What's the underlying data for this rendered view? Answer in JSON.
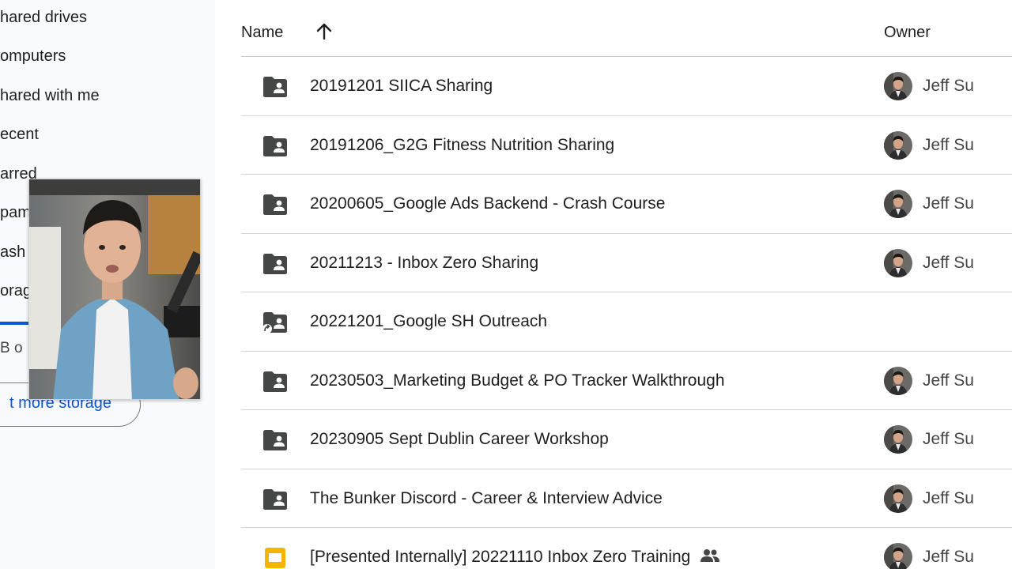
{
  "sidebar": {
    "items": [
      {
        "label": "hared drives"
      },
      {
        "label": "omputers"
      },
      {
        "label": "hared with me"
      },
      {
        "label": "ecent"
      },
      {
        "label": "arred"
      },
      {
        "label": "pam"
      },
      {
        "label": "ash"
      },
      {
        "label": "orag"
      }
    ],
    "storage": {
      "used_fraction": 0.2,
      "text": "B o",
      "button_label": "t more storage"
    }
  },
  "list": {
    "header": {
      "name_label": "Name",
      "owner_label": "Owner",
      "sort_icon": "arrow-up-icon"
    },
    "rows": [
      {
        "name": "20191201 SIICA Sharing",
        "icon": "shared-folder-icon",
        "owner": "Jeff Su"
      },
      {
        "name": "20191206_G2G Fitness Nutrition Sharing",
        "icon": "shared-folder-icon",
        "owner": "Jeff Su"
      },
      {
        "name": "20200605_Google Ads Backend - Crash Course",
        "icon": "shared-folder-icon",
        "owner": "Jeff Su"
      },
      {
        "name": "20211213 - Inbox Zero Sharing",
        "icon": "shared-folder-icon",
        "owner": "Jeff Su"
      },
      {
        "name": "20221201_Google SH Outreach",
        "icon": "shortcut-shared-folder-icon",
        "owner": ""
      },
      {
        "name": "20230503_Marketing Budget & PO Tracker Walkthrough",
        "icon": "shared-folder-icon",
        "owner": "Jeff Su"
      },
      {
        "name": "20230905 Sept Dublin Career Workshop",
        "icon": "shared-folder-icon",
        "owner": "Jeff Su"
      },
      {
        "name": "The Bunker Discord - Career & Interview Advice",
        "icon": "shared-folder-icon",
        "owner": "Jeff Su"
      },
      {
        "name": "[Presented Internally] 20221110 Inbox Zero Training",
        "icon": "google-slides-icon",
        "owner": "Jeff Su",
        "shared": true
      }
    ]
  },
  "colors": {
    "sidebar_bg": "#f8fafd",
    "accent": "#0b57d0",
    "folder_icon": "#444746",
    "slides_icon": "#f4b400",
    "divider": "#d5d5d5"
  }
}
